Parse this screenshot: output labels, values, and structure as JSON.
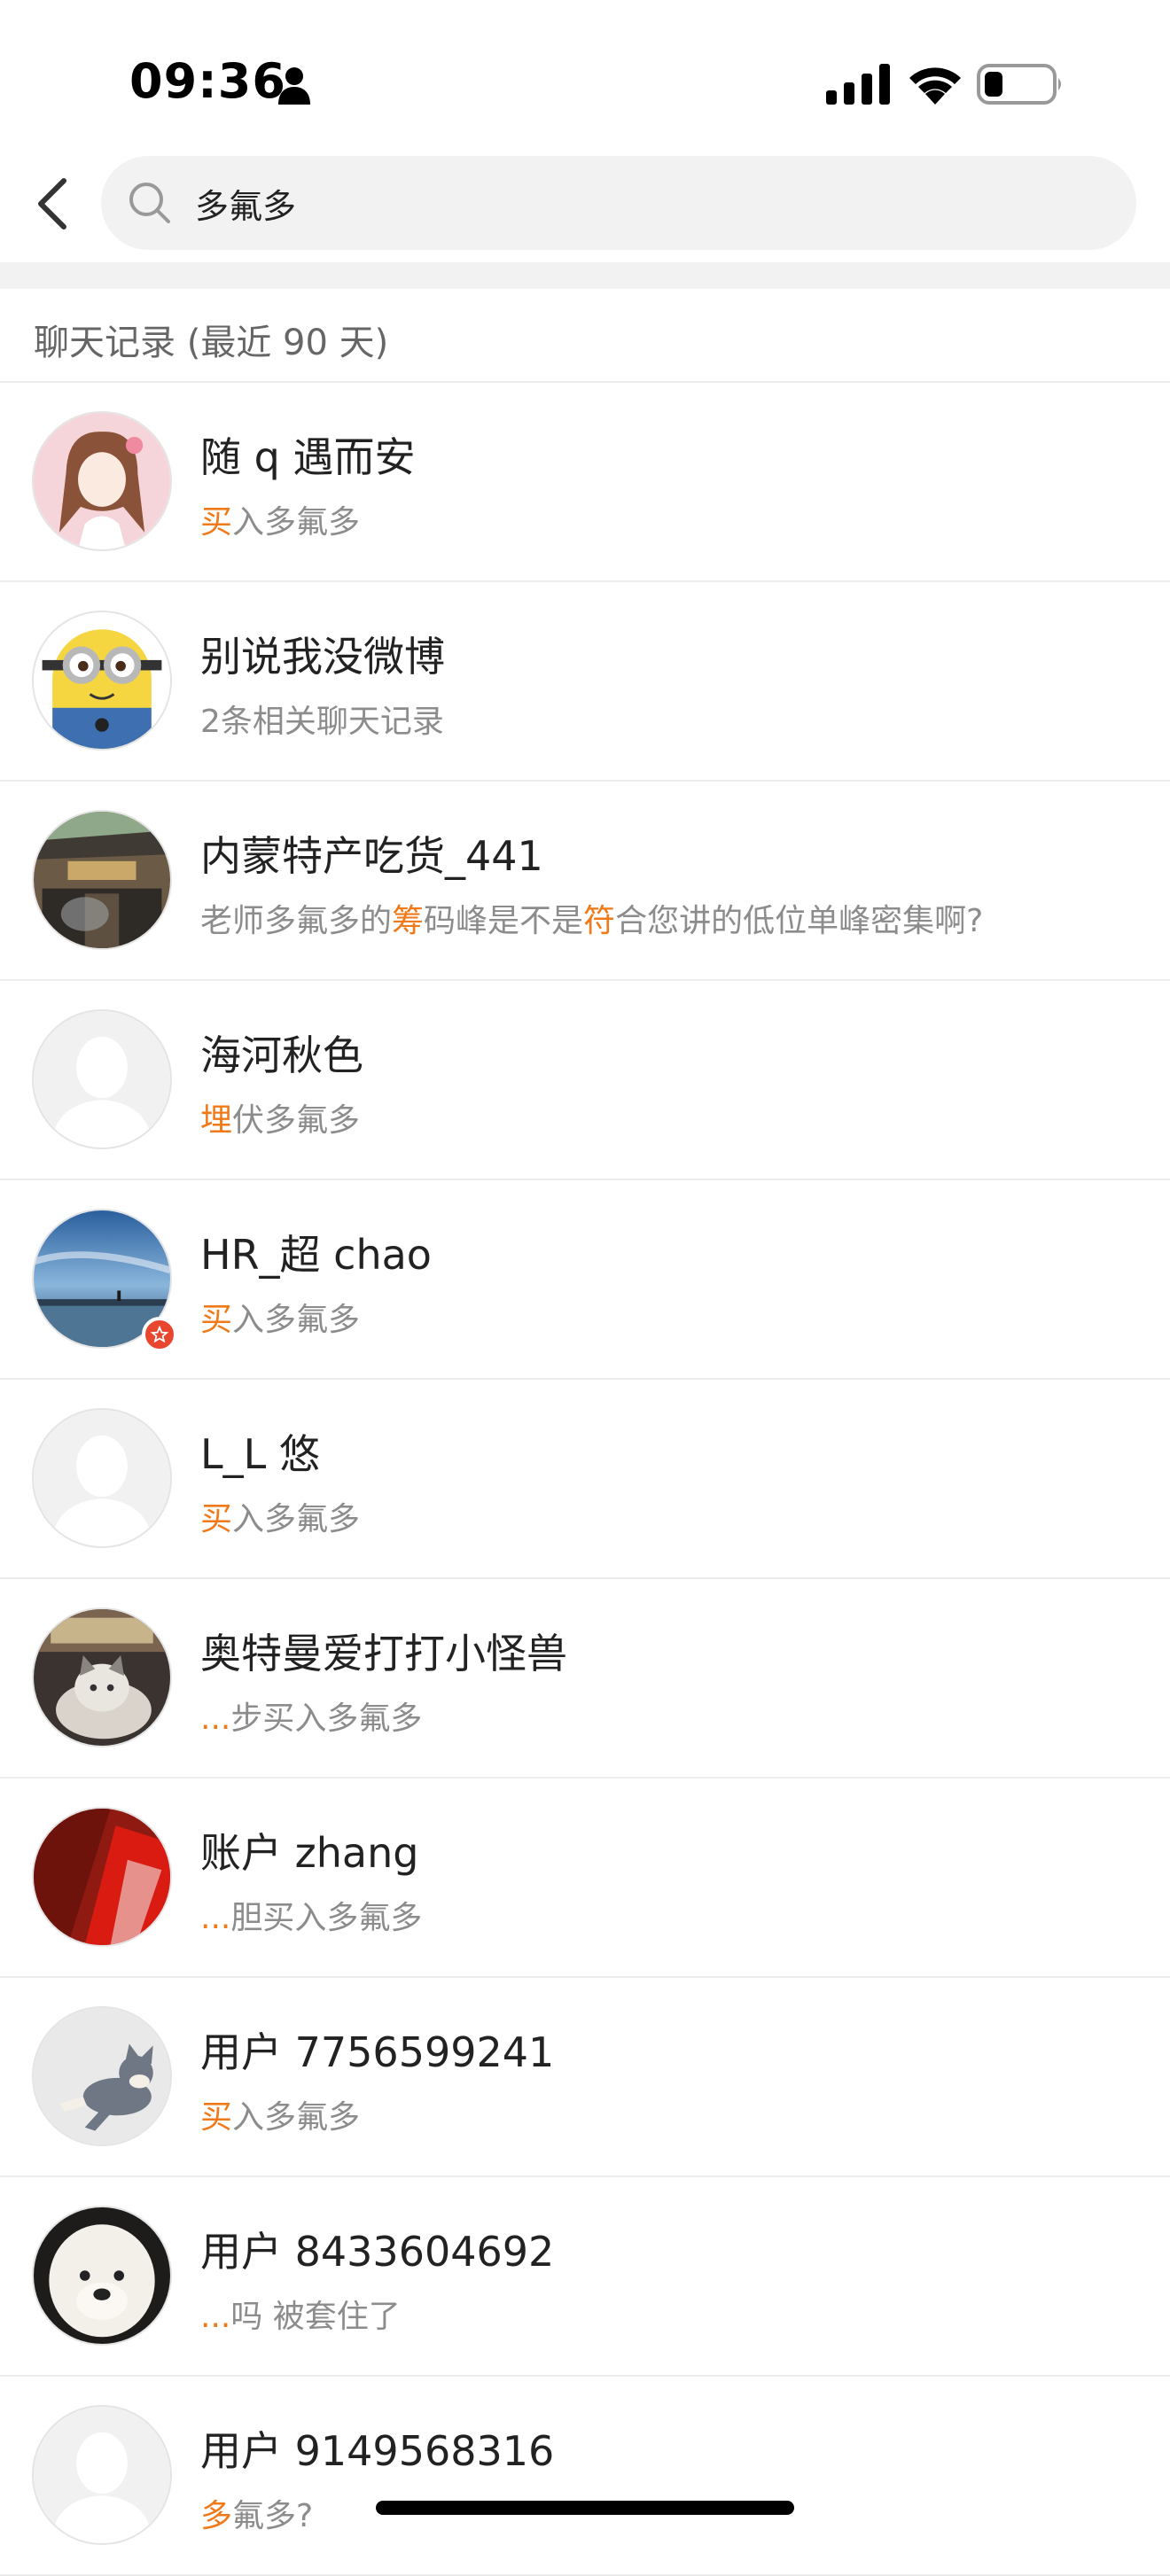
{
  "status_bar": {
    "time": "09:36",
    "icons": [
      "person-icon",
      "signal-icon",
      "wifi-icon",
      "battery-icon"
    ]
  },
  "search": {
    "query": "多氟多",
    "icons": [
      "back-chevron-icon",
      "search-icon"
    ]
  },
  "section": {
    "title": "聊天记录 (最近 90 天)"
  },
  "colors": {
    "highlight": "#f07a19",
    "divider": "#f2f2f2",
    "vip_badge": "#e8462f"
  },
  "results": [
    {
      "name": "随 q 遇而安",
      "snippet_pre": "",
      "snippet_hl": "买",
      "snippet_post": "入多氟多",
      "avatar": "girl-cartoon-avatar",
      "vip": false
    },
    {
      "name": "别说我没微博",
      "snippet_pre": "2条相关聊天记录",
      "snippet_hl": "",
      "snippet_post": "",
      "avatar": "minion-avatar",
      "vip": false
    },
    {
      "name": "内蒙特产吃货_441",
      "snippet_pre": "老师多氟多的",
      "snippet_hl": "筹",
      "snippet_mid": "码峰是不是",
      "snippet_hl2": "符",
      "snippet_post": "合您讲的低位单峰密集啊?",
      "avatar": "temple-gate-avatar",
      "vip": false
    },
    {
      "name": "海河秋色",
      "snippet_pre": "",
      "snippet_hl": "埋",
      "snippet_post": "伏多氟多",
      "avatar": "default-user-avatar",
      "vip": false
    },
    {
      "name": "HR_超 chao",
      "snippet_pre": "",
      "snippet_hl": "买",
      "snippet_post": "入多氟多",
      "avatar": "sky-lake-avatar",
      "vip": true
    },
    {
      "name": "L_L 悠",
      "snippet_pre": "",
      "snippet_hl": "买",
      "snippet_post": "入多氟多",
      "avatar": "default-user-avatar",
      "vip": false
    },
    {
      "name": "奥特曼爱打打小怪兽",
      "snippet_pre": "",
      "snippet_hl": "...",
      "snippet_post": "步买入多氟多",
      "avatar": "cat-avatar",
      "vip": false
    },
    {
      "name": "账户 zhang",
      "snippet_pre": "",
      "snippet_hl": "...",
      "snippet_post": "胆买入多氟多",
      "avatar": "red-abstract-avatar",
      "vip": false
    },
    {
      "name": "用户 7756599241",
      "snippet_pre": "",
      "snippet_hl": "买",
      "snippet_post": "入多氟多",
      "avatar": "tom-cat-cartoon-avatar",
      "vip": false
    },
    {
      "name": "用户 8433604692",
      "snippet_pre": "",
      "snippet_hl": "...",
      "snippet_post": "吗 被套住了",
      "avatar": "white-dog-avatar",
      "vip": false
    },
    {
      "name": "用户 9149568316",
      "snippet_pre": "",
      "snippet_hl": "多",
      "snippet_post": "氟多?",
      "avatar": "default-user-avatar",
      "vip": false
    }
  ]
}
